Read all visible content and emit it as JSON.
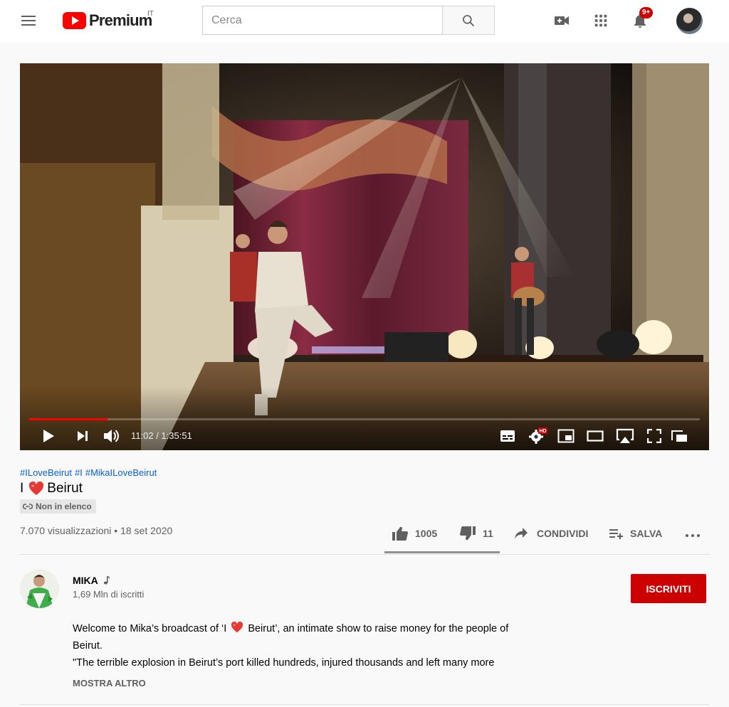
{
  "header": {
    "logo_text": "Premium",
    "country_code": "IT",
    "search_placeholder": "Cerca",
    "notifications_badge": "9+",
    "icons": [
      "menu-icon",
      "youtube-logo",
      "search-icon",
      "create-video-icon",
      "apps-grid-icon",
      "bell-icon",
      "account-avatar"
    ]
  },
  "player": {
    "time_current": "11:02",
    "time_separator": " / ",
    "time_total": "1:35:51",
    "progress_fraction": 0.117,
    "hd_badge": "HD",
    "controls": [
      "play-icon",
      "next-icon",
      "volume-icon",
      "subtitles-icon",
      "settings-icon",
      "miniplayer-icon",
      "theater-mode-icon",
      "airplay-icon",
      "fullscreen-icon",
      "pip-icon"
    ]
  },
  "video": {
    "hashtags": [
      "#ILoveBeirut",
      "#I",
      "#MikaILoveBeirut"
    ],
    "title_pre": "I",
    "title_post": "Beirut",
    "unlisted_label": "Non in elenco",
    "views": "7.070 visualizzazioni",
    "bullet": "•",
    "date": "18 set 2020"
  },
  "actions": {
    "likes": "1005",
    "dislikes": "11",
    "share_label": "CONDIVIDI",
    "save_label": "SALVA",
    "more_icon": "more-horiz-icon"
  },
  "channel": {
    "name": "MIKA",
    "subscribers": "1,69 Mln di iscritti",
    "subscribe_label": "ISCRIVITI"
  },
  "description": {
    "line1_pre": "Welcome to Mika’s broadcast of ‘I",
    "line1_post": "Beirut’, an intimate show to raise money for the people of",
    "line2": "Beirut.",
    "line3": "\"The terrible explosion in Beirut’s port killed hundreds, injured thousands and left many more",
    "show_more": "MOSTRA ALTRO"
  },
  "colors": {
    "brand_red": "#ff0000",
    "subscribe_red": "#cc0000",
    "link_blue": "#065fd4",
    "text_secondary": "#606060"
  }
}
